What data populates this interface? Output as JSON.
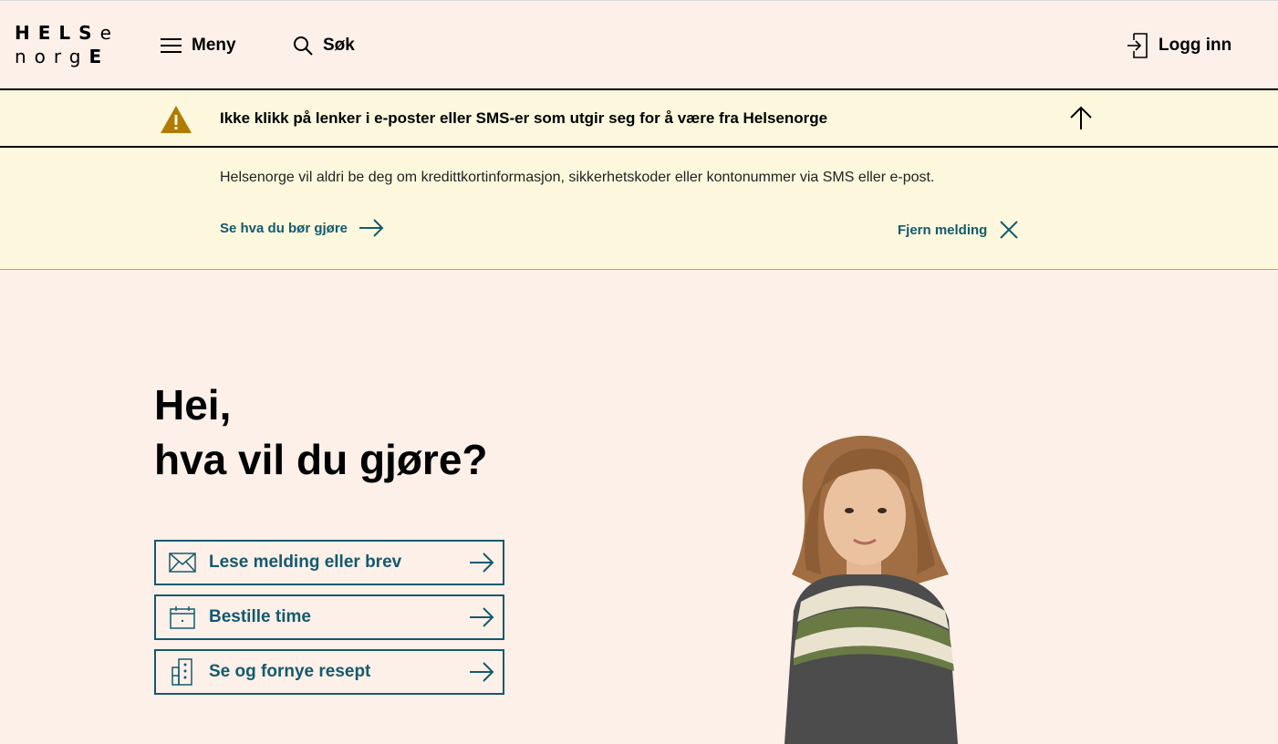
{
  "header": {
    "logo_line1_bold": "HELS",
    "logo_line1_light": "e",
    "logo_line2_light": "norg",
    "logo_line2_bold": "E",
    "menu_label": "Meny",
    "search_label": "Søk",
    "login_label": "Logg inn"
  },
  "alert": {
    "title": "Ikke klikk på lenker i e-poster eller SMS-er som utgir seg for å være fra Helsenorge",
    "text": "Helsenorge vil aldri be deg om kredittkortinformasjon, sikkerhetskoder eller kontonummer via SMS eller e-post.",
    "link_label": "Se hva du bør gjøre",
    "dismiss_label": "Fjern melding"
  },
  "hero": {
    "greeting_line1": "Hei,",
    "greeting_line2": "hva vil du gjøre?",
    "actions": [
      {
        "label": "Lese melding eller brev",
        "icon": "envelope-icon"
      },
      {
        "label": "Bestille time",
        "icon": "calendar-icon"
      },
      {
        "label": "Se og fornye resept",
        "icon": "prescription-icon"
      }
    ]
  },
  "colors": {
    "background": "#fdf0e9",
    "alert_background": "#fdf8dd",
    "accent": "#135a6e",
    "warning": "#b07b00"
  }
}
